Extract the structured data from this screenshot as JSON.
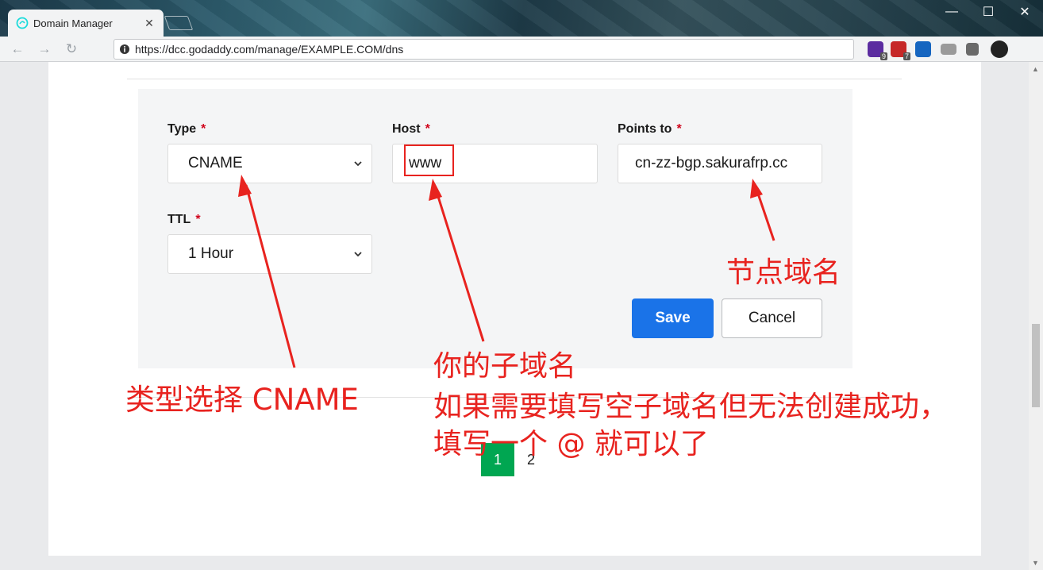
{
  "browser": {
    "tab_title": "Domain Manager",
    "tab_close": "✕",
    "url": "https://dcc.godaddy.com/manage/EXAMPLE.COM/dns",
    "window_controls": {
      "minimize": "—",
      "maximize": "☐",
      "close": "✕"
    },
    "nav": {
      "back": "←",
      "forward": "→",
      "reload": "↻"
    },
    "extensions": [
      {
        "name": "ext-purple",
        "badge": "9",
        "color": "#5b2ca0"
      },
      {
        "name": "adblock-plus",
        "badge": "7",
        "color": "#c62828",
        "label": "ABP"
      },
      {
        "name": "ext-shield",
        "badge": "",
        "color": "#1565c0"
      },
      {
        "name": "ext-screen",
        "badge": "",
        "color": "#888888"
      },
      {
        "name": "extensions-puzzle",
        "badge": "",
        "color": "#666666"
      },
      {
        "name": "profile-avatar",
        "badge": "",
        "color": "#222222"
      }
    ]
  },
  "form": {
    "type_label": "Type",
    "type_value": "CNAME",
    "host_label": "Host",
    "host_value": "www",
    "points_label": "Points to",
    "points_value": "cn-zz-bgp.sakurafrp.cc",
    "ttl_label": "TTL",
    "ttl_value": "1 Hour",
    "required_mark": "*",
    "save_label": "Save",
    "cancel_label": "Cancel"
  },
  "pagination": {
    "pages": [
      "1",
      "2"
    ],
    "active": "1"
  },
  "annotations": {
    "type_note": "类型选择 CNAME",
    "points_note": "节点域名",
    "host_note_line1": "你的子域名",
    "host_note_line2": "如果需要填写空子域名但无法创建成功，",
    "host_note_line3": "填写一个 @ 就可以了"
  },
  "colors": {
    "annotation_red": "#e8231f",
    "save_blue": "#1a73e8",
    "pager_green": "#00a651",
    "required_red": "#d0021b"
  }
}
